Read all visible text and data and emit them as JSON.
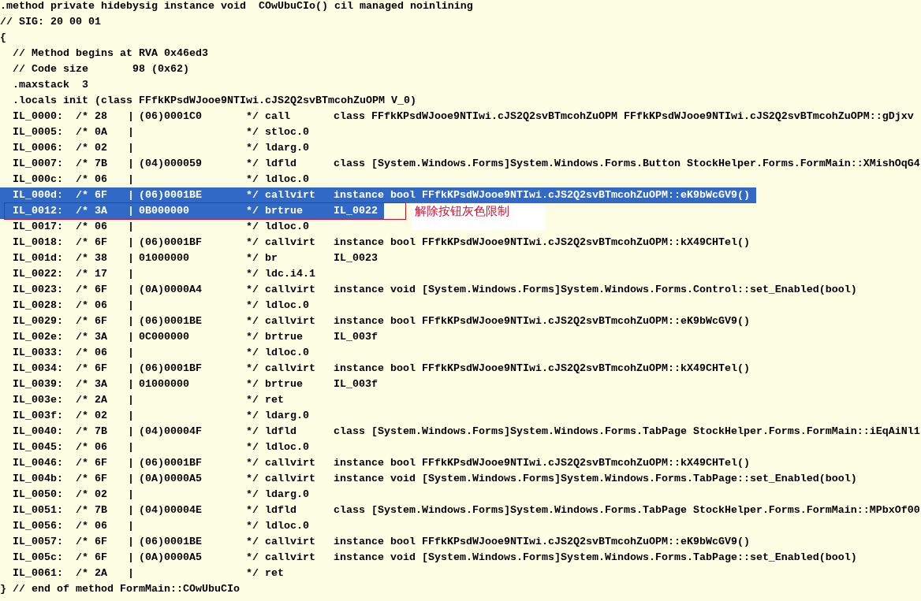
{
  "header": [
    {
      "kind": "top",
      "text": ".method private hidebysig instance void  COwUbuCIo() cil managed noinlining"
    },
    {
      "kind": "top",
      "text": "// SIG: 20 00 01"
    },
    {
      "kind": "top",
      "text": "{"
    },
    {
      "kind": "body",
      "text": "// Method begins at RVA 0x46ed3"
    },
    {
      "kind": "body",
      "text": "// Code size       98 (0x62)"
    },
    {
      "kind": "body",
      "text": ".maxstack  3"
    },
    {
      "kind": "body",
      "text": ".locals init (class FFfkKPsdWJooe9NTIwi.cJS2Q2svBTmcohZuOPM V_0)"
    }
  ],
  "rows": [
    {
      "offset": "IL_0000:",
      "bytes": "/* 28",
      "bar": "|",
      "token": "(06)0001C0",
      "close": "*/",
      "opcode": "call",
      "operand": "class FFfkKPsdWJooe9NTIwi.cJS2Q2svBTmcohZuOPM FFfkKPsdWJooe9NTIwi.cJS2Q2svBTmcohZuOPM::gDjxv",
      "selected": false
    },
    {
      "offset": "IL_0005:",
      "bytes": "/* 0A",
      "bar": "|",
      "close": "*/",
      "opcode": "stloc.0",
      "selected": false
    },
    {
      "offset": "IL_0006:",
      "bytes": "/* 02",
      "bar": "|",
      "close": "*/",
      "opcode": "ldarg.0",
      "selected": false
    },
    {
      "offset": "IL_0007:",
      "bytes": "/* 7B",
      "bar": "|",
      "token": "(04)000059",
      "close": "*/",
      "opcode": "ldfld",
      "operand": "class [System.Windows.Forms]System.Windows.Forms.Button StockHelper.Forms.FormMain::XMishOqG4",
      "selected": false
    },
    {
      "offset": "IL_000c:",
      "bytes": "/* 06",
      "bar": "|",
      "close": "*/",
      "opcode": "ldloc.0",
      "selected": false
    },
    {
      "offset": "IL_000d:",
      "bytes": "/* 6F",
      "bar": "|",
      "token": "(06)0001BE",
      "close": "*/",
      "opcode": "callvirt",
      "operand": "instance bool FFfkKPsdWJooe9NTIwi.cJS2Q2svBTmcohZuOPM::eK9bWcGV9()",
      "selected": true
    },
    {
      "offset": "IL_0012:",
      "bytes": "/* 3A",
      "bar": "|",
      "token": "0B000000",
      "close": "*/",
      "opcode": "brtrue",
      "operand": "IL_0022",
      "selected": true,
      "note": "解除按钮灰色限制"
    },
    {
      "offset": "IL_0017:",
      "bytes": "/* 06",
      "bar": "|",
      "close": "*/",
      "opcode": "ldloc.0",
      "selected": false
    },
    {
      "offset": "IL_0018:",
      "bytes": "/* 6F",
      "bar": "|",
      "token": "(06)0001BF",
      "close": "*/",
      "opcode": "callvirt",
      "operand": "instance bool FFfkKPsdWJooe9NTIwi.cJS2Q2svBTmcohZuOPM::kX49CHTel()",
      "selected": false
    },
    {
      "offset": "IL_001d:",
      "bytes": "/* 38",
      "bar": "|",
      "token": "01000000",
      "close": "*/",
      "opcode": "br",
      "operand": "IL_0023",
      "selected": false
    },
    {
      "offset": "IL_0022:",
      "bytes": "/* 17",
      "bar": "|",
      "close": "*/",
      "opcode": "ldc.i4.1",
      "selected": false
    },
    {
      "offset": "IL_0023:",
      "bytes": "/* 6F",
      "bar": "|",
      "token": "(0A)0000A4",
      "close": "*/",
      "opcode": "callvirt",
      "operand": "instance void [System.Windows.Forms]System.Windows.Forms.Control::set_Enabled(bool)",
      "selected": false
    },
    {
      "offset": "IL_0028:",
      "bytes": "/* 06",
      "bar": "|",
      "close": "*/",
      "opcode": "ldloc.0",
      "selected": false
    },
    {
      "offset": "IL_0029:",
      "bytes": "/* 6F",
      "bar": "|",
      "token": "(06)0001BE",
      "close": "*/",
      "opcode": "callvirt",
      "operand": "instance bool FFfkKPsdWJooe9NTIwi.cJS2Q2svBTmcohZuOPM::eK9bWcGV9()",
      "selected": false
    },
    {
      "offset": "IL_002e:",
      "bytes": "/* 3A",
      "bar": "|",
      "token": "0C000000",
      "close": "*/",
      "opcode": "brtrue",
      "operand": "IL_003f",
      "selected": false
    },
    {
      "offset": "IL_0033:",
      "bytes": "/* 06",
      "bar": "|",
      "close": "*/",
      "opcode": "ldloc.0",
      "selected": false
    },
    {
      "offset": "IL_0034:",
      "bytes": "/* 6F",
      "bar": "|",
      "token": "(06)0001BF",
      "close": "*/",
      "opcode": "callvirt",
      "operand": "instance bool FFfkKPsdWJooe9NTIwi.cJS2Q2svBTmcohZuOPM::kX49CHTel()",
      "selected": false
    },
    {
      "offset": "IL_0039:",
      "bytes": "/* 3A",
      "bar": "|",
      "token": "01000000",
      "close": "*/",
      "opcode": "brtrue",
      "operand": "IL_003f",
      "selected": false
    },
    {
      "offset": "IL_003e:",
      "bytes": "/* 2A",
      "bar": "|",
      "close": "*/",
      "opcode": "ret",
      "selected": false
    },
    {
      "offset": "IL_003f:",
      "bytes": "/* 02",
      "bar": "|",
      "close": "*/",
      "opcode": "ldarg.0",
      "selected": false
    },
    {
      "offset": "IL_0040:",
      "bytes": "/* 7B",
      "bar": "|",
      "token": "(04)00004F",
      "close": "*/",
      "opcode": "ldfld",
      "operand": "class [System.Windows.Forms]System.Windows.Forms.TabPage StockHelper.Forms.FormMain::iEqAiNl1",
      "selected": false
    },
    {
      "offset": "IL_0045:",
      "bytes": "/* 06",
      "bar": "|",
      "close": "*/",
      "opcode": "ldloc.0",
      "selected": false
    },
    {
      "offset": "IL_0046:",
      "bytes": "/* 6F",
      "bar": "|",
      "token": "(06)0001BF",
      "close": "*/",
      "opcode": "callvirt",
      "operand": "instance bool FFfkKPsdWJooe9NTIwi.cJS2Q2svBTmcohZuOPM::kX49CHTel()",
      "selected": false
    },
    {
      "offset": "IL_004b:",
      "bytes": "/* 6F",
      "bar": "|",
      "token": "(0A)0000A5",
      "close": "*/",
      "opcode": "callvirt",
      "operand": "instance void [System.Windows.Forms]System.Windows.Forms.TabPage::set_Enabled(bool)",
      "selected": false
    },
    {
      "offset": "IL_0050:",
      "bytes": "/* 02",
      "bar": "|",
      "close": "*/",
      "opcode": "ldarg.0",
      "selected": false
    },
    {
      "offset": "IL_0051:",
      "bytes": "/* 7B",
      "bar": "|",
      "token": "(04)00004E",
      "close": "*/",
      "opcode": "ldfld",
      "operand": "class [System.Windows.Forms]System.Windows.Forms.TabPage StockHelper.Forms.FormMain::MPbxOf00",
      "selected": false
    },
    {
      "offset": "IL_0056:",
      "bytes": "/* 06",
      "bar": "|",
      "close": "*/",
      "opcode": "ldloc.0",
      "selected": false
    },
    {
      "offset": "IL_0057:",
      "bytes": "/* 6F",
      "bar": "|",
      "token": "(06)0001BE",
      "close": "*/",
      "opcode": "callvirt",
      "operand": "instance bool FFfkKPsdWJooe9NTIwi.cJS2Q2svBTmcohZuOPM::eK9bWcGV9()",
      "selected": false
    },
    {
      "offset": "IL_005c:",
      "bytes": "/* 6F",
      "bar": "|",
      "token": "(0A)0000A5",
      "close": "*/",
      "opcode": "callvirt",
      "operand": "instance void [System.Windows.Forms]System.Windows.Forms.TabPage::set_Enabled(bool)",
      "selected": false
    },
    {
      "offset": "IL_0061:",
      "bytes": "/* 2A",
      "bar": "|",
      "close": "*/",
      "opcode": "ret",
      "selected": false
    }
  ],
  "footer": "} // end of method FormMain::COwUbuCIo"
}
